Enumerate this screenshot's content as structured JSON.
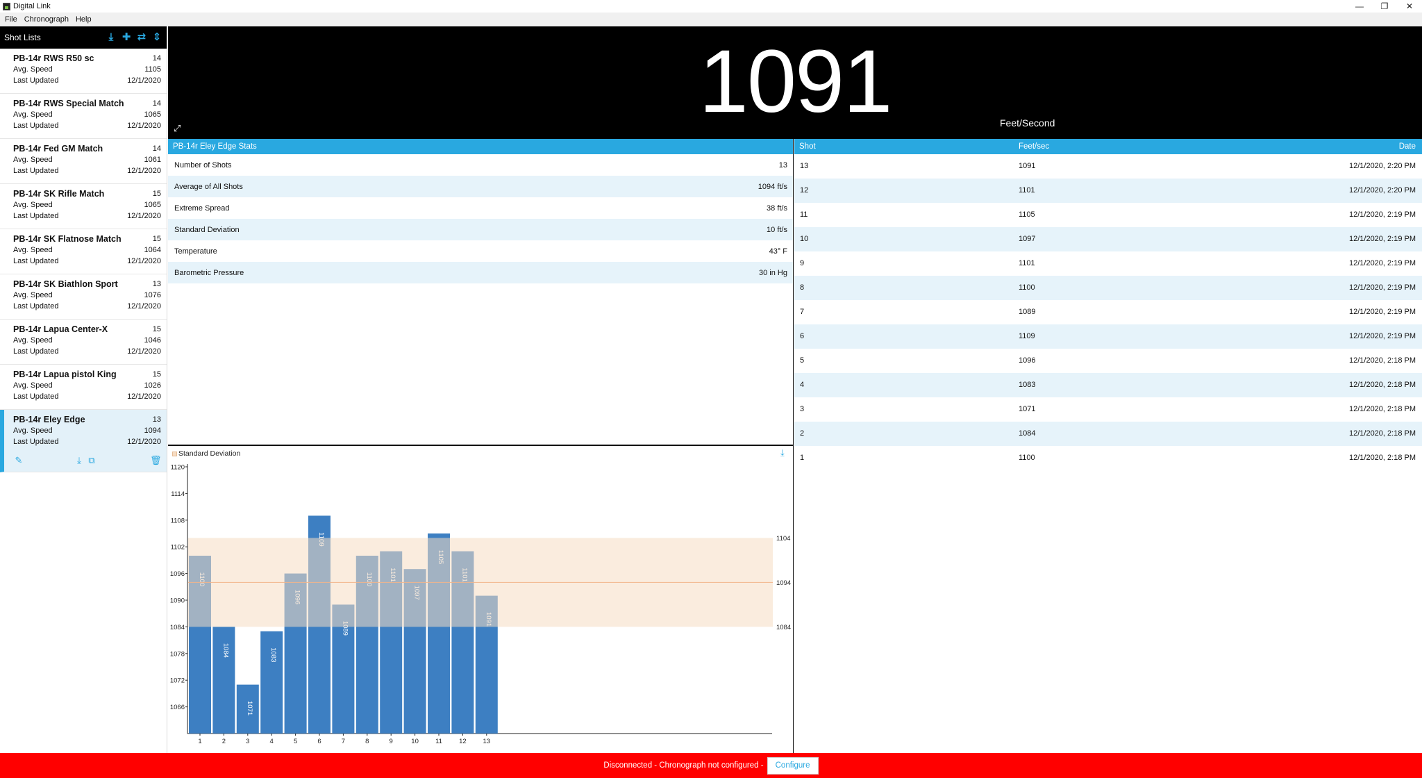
{
  "window": {
    "title": "Digital Link",
    "controls": [
      "minimize-icon",
      "restore-icon",
      "close-icon"
    ]
  },
  "menu": [
    "File",
    "Chronograph",
    "Help"
  ],
  "sidebar": {
    "title": "Shot Lists",
    "toolbar_icons": [
      "download-icon",
      "add-icon",
      "transfer-icon",
      "sort-icon"
    ],
    "items": [
      {
        "name": "PB-14r RWS R50 sc",
        "count": "14",
        "avg_label": "Avg. Speed",
        "avg": "1105",
        "updated_label": "Last Updated",
        "updated": "12/1/2020"
      },
      {
        "name": "PB-14r RWS Special Match",
        "count": "14",
        "avg_label": "Avg. Speed",
        "avg": "1065",
        "updated_label": "Last Updated",
        "updated": "12/1/2020"
      },
      {
        "name": "PB-14r Fed GM Match",
        "count": "14",
        "avg_label": "Avg. Speed",
        "avg": "1061",
        "updated_label": "Last Updated",
        "updated": "12/1/2020"
      },
      {
        "name": "PB-14r SK Rifle Match",
        "count": "15",
        "avg_label": "Avg. Speed",
        "avg": "1065",
        "updated_label": "Last Updated",
        "updated": "12/1/2020"
      },
      {
        "name": "PB-14r SK Flatnose Match",
        "count": "15",
        "avg_label": "Avg. Speed",
        "avg": "1064",
        "updated_label": "Last Updated",
        "updated": "12/1/2020"
      },
      {
        "name": "PB-14r SK Biathlon Sport",
        "count": "13",
        "avg_label": "Avg. Speed",
        "avg": "1076",
        "updated_label": "Last Updated",
        "updated": "12/1/2020"
      },
      {
        "name": "PB-14r Lapua Center-X",
        "count": "15",
        "avg_label": "Avg. Speed",
        "avg": "1046",
        "updated_label": "Last Updated",
        "updated": "12/1/2020"
      },
      {
        "name": "PB-14r Lapua pistol King",
        "count": "15",
        "avg_label": "Avg. Speed",
        "avg": "1026",
        "updated_label": "Last Updated",
        "updated": "12/1/2020"
      },
      {
        "name": "PB-14r Eley Edge",
        "count": "13",
        "avg_label": "Avg. Speed",
        "avg": "1094",
        "updated_label": "Last Updated",
        "updated": "12/1/2020",
        "selected": true
      }
    ],
    "selected_actions": [
      "edit-icon",
      "download-icon",
      "copy-icon",
      "delete-icon"
    ]
  },
  "readout": {
    "value": "1091",
    "unit": "Feet/Second"
  },
  "stats": {
    "title": "PB-14r Eley Edge Stats",
    "rows": [
      {
        "label": "Number of Shots",
        "value": "13"
      },
      {
        "label": "Average of All Shots",
        "value": "1094 ft/s"
      },
      {
        "label": "Extreme Spread",
        "value": "38 ft/s"
      },
      {
        "label": "Standard Deviation",
        "value": "10 ft/s"
      },
      {
        "label": "Temperature",
        "value": "43° F"
      },
      {
        "label": "Barometric Pressure",
        "value": "30 in Hg"
      }
    ]
  },
  "shots_table": {
    "headers": {
      "shot": "Shot",
      "speed": "Feet/sec",
      "date": "Date"
    },
    "rows": [
      {
        "shot": "13",
        "speed": "1091",
        "date": "12/1/2020, 2:20 PM"
      },
      {
        "shot": "12",
        "speed": "1101",
        "date": "12/1/2020, 2:20 PM"
      },
      {
        "shot": "11",
        "speed": "1105",
        "date": "12/1/2020, 2:19 PM"
      },
      {
        "shot": "10",
        "speed": "1097",
        "date": "12/1/2020, 2:19 PM"
      },
      {
        "shot": "9",
        "speed": "1101",
        "date": "12/1/2020, 2:19 PM"
      },
      {
        "shot": "8",
        "speed": "1100",
        "date": "12/1/2020, 2:19 PM"
      },
      {
        "shot": "7",
        "speed": "1089",
        "date": "12/1/2020, 2:19 PM"
      },
      {
        "shot": "6",
        "speed": "1109",
        "date": "12/1/2020, 2:19 PM"
      },
      {
        "shot": "5",
        "speed": "1096",
        "date": "12/1/2020, 2:18 PM"
      },
      {
        "shot": "4",
        "speed": "1083",
        "date": "12/1/2020, 2:18 PM"
      },
      {
        "shot": "3",
        "speed": "1071",
        "date": "12/1/2020, 2:18 PM"
      },
      {
        "shot": "2",
        "speed": "1084",
        "date": "12/1/2020, 2:18 PM"
      },
      {
        "shot": "1",
        "speed": "1100",
        "date": "12/1/2020, 2:18 PM"
      }
    ]
  },
  "chart_data": {
    "type": "bar",
    "legend": "Standard Deviation",
    "categories": [
      "1",
      "2",
      "3",
      "4",
      "5",
      "6",
      "7",
      "8",
      "9",
      "10",
      "11",
      "12",
      "13"
    ],
    "values": [
      1100,
      1084,
      1071,
      1083,
      1096,
      1109,
      1089,
      1100,
      1101,
      1097,
      1105,
      1101,
      1091
    ],
    "ylim": [
      1060,
      1120
    ],
    "yticks": [
      "1120",
      "1114",
      "1108",
      "1102",
      "1096",
      "1090",
      "1084",
      "1078",
      "1072",
      "1066"
    ],
    "band": {
      "low": 1084,
      "mean": 1094,
      "high": 1104
    },
    "band_labels": [
      "1104",
      "1094",
      "1084"
    ],
    "colors": {
      "bar": "#3d7fc2",
      "band": "#f6dcc3",
      "band_line": "#f2b48a"
    }
  },
  "status": {
    "message": "Disconnected - Chronograph not configured -",
    "button": "Configure"
  }
}
